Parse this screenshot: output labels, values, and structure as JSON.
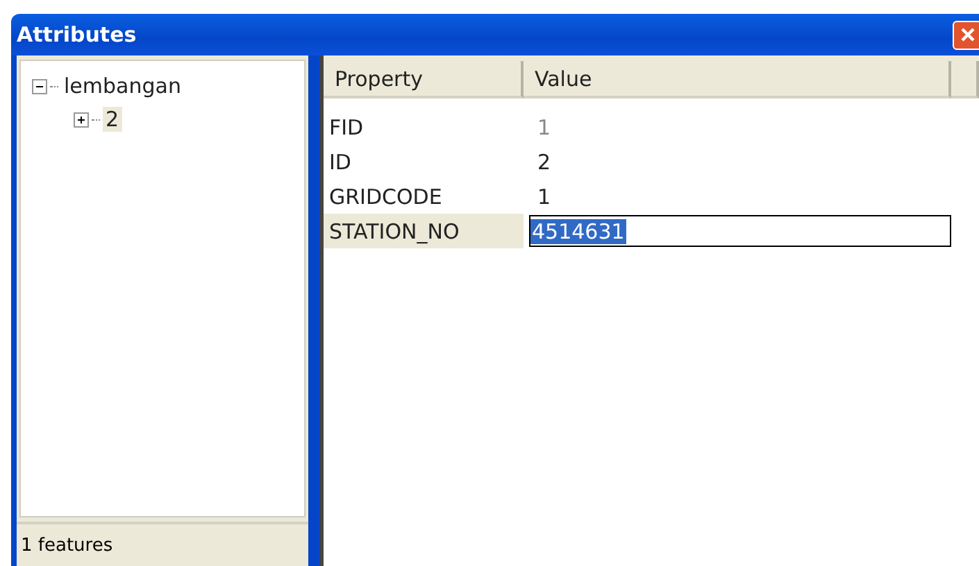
{
  "window": {
    "title": "Attributes"
  },
  "tree": [
    {
      "label": "lembangan",
      "expanded": true,
      "selected": false,
      "children": [
        {
          "label": "2",
          "expanded": false,
          "selected": true
        }
      ]
    }
  ],
  "status_bar": "1 features",
  "table": {
    "columns": [
      "Property",
      "Value"
    ],
    "rows": [
      {
        "property": "FID",
        "value": "1",
        "readonly": true,
        "selected": false
      },
      {
        "property": "ID",
        "value": "2",
        "readonly": false,
        "selected": false
      },
      {
        "property": "GRIDCODE",
        "value": "1",
        "readonly": false,
        "selected": false
      },
      {
        "property": "STATION_NO",
        "value": "4514631",
        "readonly": false,
        "selected": true
      }
    ]
  }
}
